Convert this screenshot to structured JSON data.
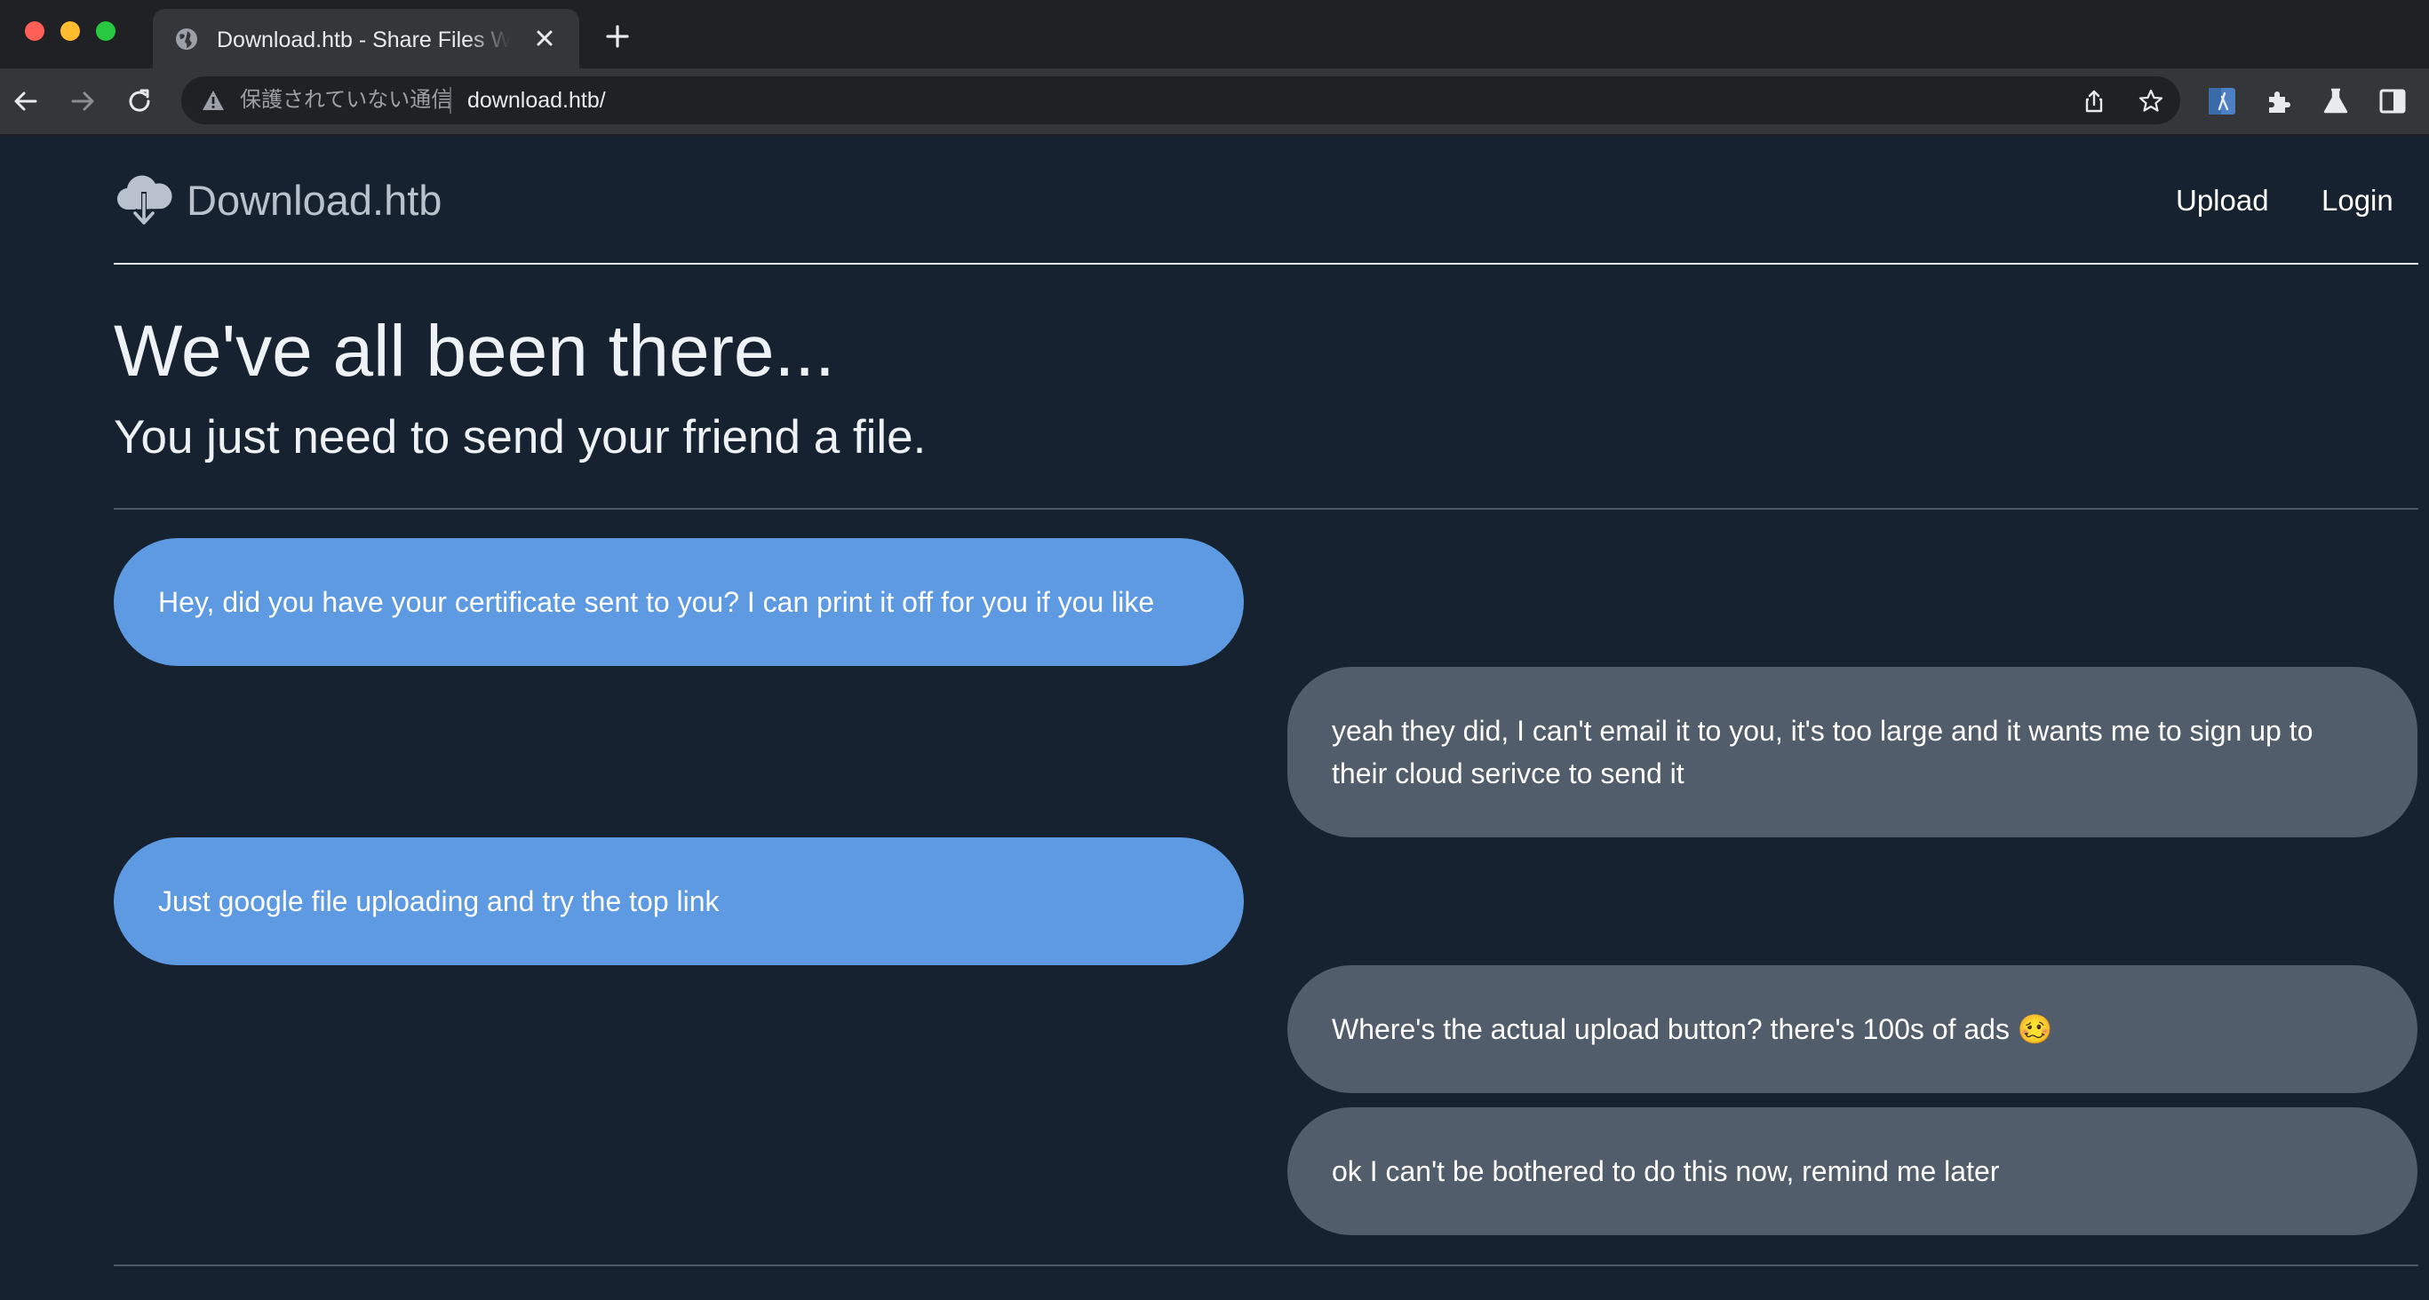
{
  "browser": {
    "tab_title": "Download.htb - Share Files With Ease",
    "new_tab_symbol": "+",
    "security_label": "保護されていない通信",
    "url": "download.htb/"
  },
  "header": {
    "brand": "Download.htb",
    "nav": {
      "upload": "Upload",
      "login": "Login"
    }
  },
  "hero": {
    "title": "We've all been there...",
    "subtitle": "You just need to send your friend a file."
  },
  "chat": {
    "messages": [
      {
        "side": "sent",
        "text": "Hey, did you have your certificate sent to you? I can print it off for you if you like"
      },
      {
        "side": "received",
        "text": "yeah they did, I can't email it to you, it's too large and it wants me to sign up to their cloud serivce to send it"
      },
      {
        "side": "sent",
        "text": "Just google file uploading and try the top link"
      },
      {
        "side": "received",
        "text": "Where's the actual upload button? there's 100s of ads 🥴"
      },
      {
        "side": "received",
        "text": "ok I can't be bothered to do this now, remind me later"
      }
    ]
  },
  "colors": {
    "page_background": "#16222f",
    "sent_bubble": "#5d9ae2",
    "received_bubble": "#515d6a",
    "brand_text": "#b9c2cc"
  },
  "icons": {
    "brand": "cloud-download-icon",
    "favicon": "globe-icon"
  }
}
